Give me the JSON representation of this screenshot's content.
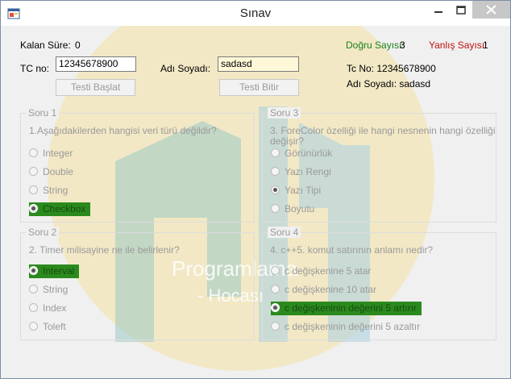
{
  "window": {
    "title": "Sınav"
  },
  "colors": {
    "correct": "#198019",
    "wrong": "#c01010",
    "highlight": "#2b8a1e"
  },
  "top": {
    "kalan_label": "Kalan Süre:",
    "kalan_value": "0",
    "dogru_label": "Doğru Sayısı:",
    "dogru_value": "3",
    "yanlis_label": "Yanlış Sayısı:",
    "yanlis_value": "1",
    "tc_label": "TC no:",
    "tc_value": "12345678900",
    "adsoyad_label": "Adı Soyadı:",
    "adsoyad_value": "sadasd",
    "info_tc": "Tc No: 12345678900",
    "info_ad": "Adı Soyadı: sadasd",
    "start_button": "Testi Başlat",
    "finish_button": "Testi Bitir"
  },
  "questions": [
    {
      "title": "Soru 1",
      "text": "1.Aşağıdakilerden hangisi veri türü değildir?",
      "options": [
        "Integer",
        "Double",
        "String",
        "Checkbox"
      ],
      "selected": 3,
      "highlight": 3
    },
    {
      "title": "Soru 2",
      "text": "2. Timer milisayine ne ile belirlenir?",
      "options": [
        "Interval",
        "String",
        "Index",
        "Toleft"
      ],
      "selected": 0,
      "highlight": 0
    },
    {
      "title": "Soru 3",
      "text_line1": "3. ForeColor özelliği ile hangi nesnenin hangi özelliği",
      "text_line2": "değişir?",
      "options": [
        "Görünürlük",
        "Yazı Rengi",
        "Yazı Tipi",
        "Boyutu"
      ],
      "selected": 2,
      "highlight": null
    },
    {
      "title": "Soru 4",
      "text": "4. c++5. komut satırının anlamı nedir?",
      "options": [
        "c değişkenine 5 atar",
        "c değişkenine 10 atar",
        "c değişkeninin değerini 5 artırır",
        "c değişkeninin değerini 5 azaltır"
      ],
      "selected": 2,
      "highlight": 2
    }
  ],
  "watermark": {
    "line1": "Programlama",
    "line2": "- Hocası"
  }
}
